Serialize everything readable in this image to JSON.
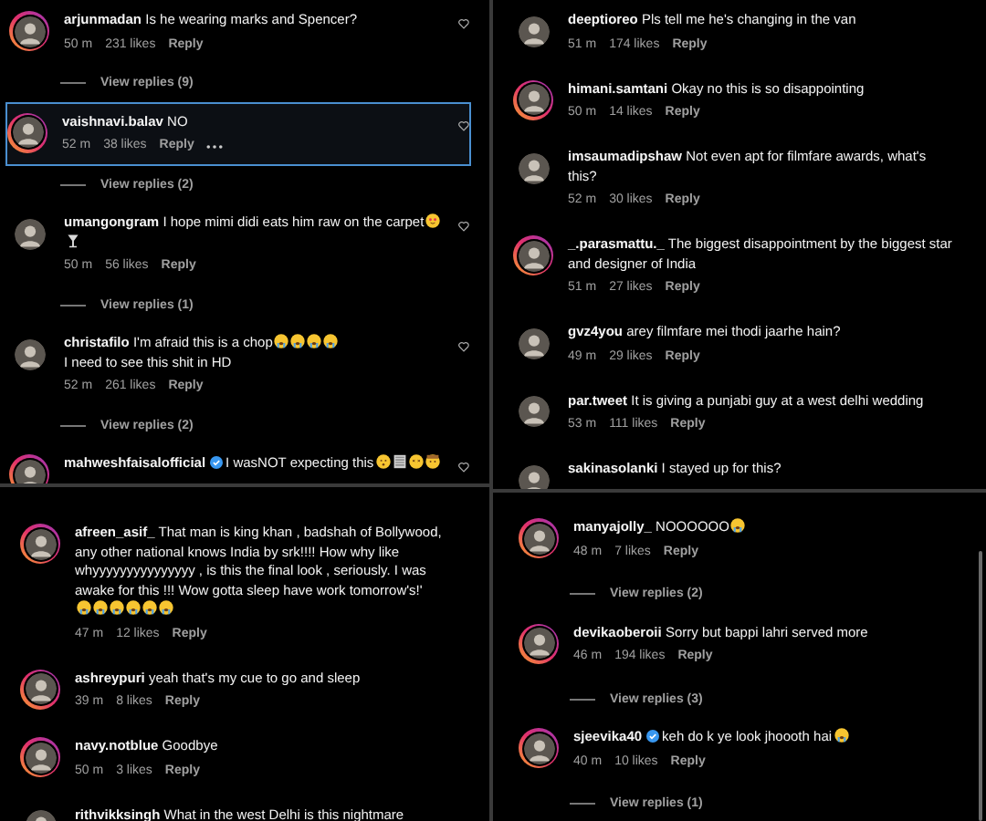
{
  "panels": [
    {
      "like_buttons": true,
      "comments": [
        {
          "username": "arjunmadan",
          "ring": true,
          "selected": false,
          "text": "Is he wearing marks and Spencer?",
          "time": "50 m",
          "likes": "231 likes",
          "reply": "Reply",
          "view_replies": "View replies (9)"
        },
        {
          "username": "vaishnavi.balav",
          "ring": true,
          "selected": true,
          "more": true,
          "text": "NO",
          "time": "52 m",
          "likes": "38 likes",
          "reply": "Reply",
          "view_replies": "View replies (2)"
        },
        {
          "username": "umangongram",
          "ring": false,
          "selected": false,
          "text": "I hope mimi didi eats him raw on the carpet",
          "emojis": [
            {
              "kind": "hearts"
            },
            {
              "kind": "glass"
            }
          ],
          "time": "50 m",
          "likes": "56 likes",
          "reply": "Reply",
          "view_replies": "View replies (1)"
        },
        {
          "username": "christafilo",
          "ring": false,
          "selected": false,
          "text": "I'm afraid this is a chop",
          "emojis": [
            {
              "kind": "sob"
            },
            {
              "kind": "sob"
            },
            {
              "kind": "sob"
            },
            {
              "kind": "sob"
            }
          ],
          "extra_line": "I need to see this shit in HD",
          "time": "52 m",
          "likes": "261 likes",
          "reply": "Reply",
          "view_replies": "View replies (2)"
        },
        {
          "username": "mahweshfaisalofficial",
          "verified": true,
          "ring": true,
          "selected": false,
          "text": "I wasNOT expecting this",
          "emojis": [
            {
              "kind": "face"
            },
            {
              "kind": "scroll"
            },
            {
              "kind": "dizzy"
            },
            {
              "kind": "cowboy"
            }
          ]
        }
      ]
    },
    {
      "comments": [
        {
          "username": "deeptioreo",
          "ring": false,
          "selected": false,
          "text": "Pls tell me he's changing in the van",
          "time": "51 m",
          "likes": "174 likes",
          "reply": "Reply"
        },
        {
          "username": "himani.samtani",
          "ring": true,
          "selected": false,
          "text": "Okay no this is so disappointing",
          "time": "50 m",
          "likes": "14 likes",
          "reply": "Reply"
        },
        {
          "username": "imsaumadipshaw",
          "ring": false,
          "selected": false,
          "text": "Not even apt for filmfare awards, what's this?",
          "time": "52 m",
          "likes": "30 likes",
          "reply": "Reply"
        },
        {
          "username": "_.parasmattu._",
          "ring": true,
          "selected": false,
          "text": "The biggest disappointment by the biggest star and designer of India",
          "time": "51 m",
          "likes": "27 likes",
          "reply": "Reply"
        },
        {
          "username": "gvz4you",
          "ring": false,
          "selected": false,
          "text": "arey filmfare mei thodi jaarhe hain?",
          "time": "49 m",
          "likes": "29 likes",
          "reply": "Reply"
        },
        {
          "username": "par.tweet",
          "ring": false,
          "selected": false,
          "text": "It is giving a punjabi guy at a west delhi wedding",
          "time": "53 m",
          "likes": "111 likes",
          "reply": "Reply"
        },
        {
          "username": "sakinasolanki",
          "ring": false,
          "selected": false,
          "text": "I stayed up for this?"
        }
      ]
    },
    {
      "comments": [
        {
          "username": "afreen_asif_",
          "ring": true,
          "selected": false,
          "text": "That man is king khan , badshah of Bollywood, any other national knows India by srk!!!! How why like whyyyyyyyyyyyyyyy , is this the final look , seriously. I was awake for this !!! Wow gotta sleep have work tomorrow's!'",
          "emojis": [
            {
              "kind": "sob"
            },
            {
              "kind": "sob"
            },
            {
              "kind": "sob"
            },
            {
              "kind": "sob"
            },
            {
              "kind": "sob"
            },
            {
              "kind": "sob"
            }
          ],
          "time": "47 m",
          "likes": "12 likes",
          "reply": "Reply"
        },
        {
          "username": "ashreypuri",
          "ring": true,
          "selected": false,
          "text": "yeah that's my cue to go and sleep",
          "time": "39 m",
          "likes": "8 likes",
          "reply": "Reply"
        },
        {
          "username": "navy.notblue",
          "ring": true,
          "selected": false,
          "text": "Goodbye",
          "time": "50 m",
          "likes": "3 likes",
          "reply": "Reply"
        },
        {
          "username": "rithvikksingh",
          "ring": false,
          "selected": false,
          "text": "What in the west Delhi is this nightmare"
        }
      ]
    },
    {
      "scrollbar": true,
      "comments": [
        {
          "username": "manyajolly_",
          "ring": true,
          "selected": false,
          "text": "NOOOOOO",
          "emojis": [
            {
              "kind": "sob"
            }
          ],
          "time": "48 m",
          "likes": "7 likes",
          "reply": "Reply",
          "view_replies": "View replies (2)"
        },
        {
          "username": "devikaoberoii",
          "ring": true,
          "selected": false,
          "text": "Sorry but bappi lahri served more",
          "time": "46 m",
          "likes": "194 likes",
          "reply": "Reply",
          "view_replies": "View replies (3)"
        },
        {
          "username": "sjeevika40",
          "verified": true,
          "ring": true,
          "selected": false,
          "text": "keh do k ye look jhoooth hai",
          "emojis": [
            {
              "kind": "sob"
            }
          ],
          "time": "40 m",
          "likes": "10 likes",
          "reply": "Reply",
          "view_replies": "View replies (1)"
        }
      ]
    }
  ]
}
